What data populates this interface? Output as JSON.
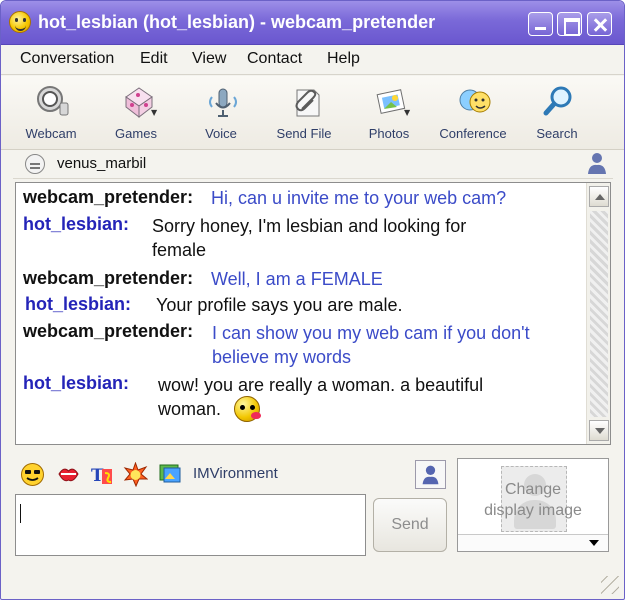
{
  "window": {
    "title": "hot_lesbian  (hot_lesbian) - webcam_pretender",
    "controls": [
      "minimize-icon",
      "maximize-icon",
      "close-icon"
    ]
  },
  "menu": {
    "items": [
      "Conversation",
      "Edit",
      "View",
      "Contact",
      "Help"
    ]
  },
  "toolbar": {
    "items": [
      {
        "label": "Webcam",
        "icon": "webcam-icon"
      },
      {
        "label": "Games",
        "icon": "dice-icon"
      },
      {
        "label": "Voice",
        "icon": "microphone-icon"
      },
      {
        "label": "Send File",
        "icon": "paperclip-file-icon"
      },
      {
        "label": "Photos",
        "icon": "photo-icon"
      },
      {
        "label": "Conference",
        "icon": "conference-icon"
      },
      {
        "label": "Search",
        "icon": "magnifier-icon"
      }
    ]
  },
  "contact": {
    "name": "venus_marbil",
    "status_icon": "contact-status-icon"
  },
  "conversation": {
    "messages": [
      {
        "sender": "webcam_pretender:",
        "text": "Hi, can u invite me to your web cam?",
        "sender_color": "#111111",
        "text_color": "#3b4bc8"
      },
      {
        "sender": "hot_lesbian:",
        "text": "Sorry honey, I'm lesbian and looking for female",
        "sender_color": "#2424b8",
        "text_color": "#111111"
      },
      {
        "sender": "webcam_pretender:",
        "text": "Well, I am a FEMALE",
        "sender_color": "#111111",
        "text_color": "#3b4bc8"
      },
      {
        "sender": "hot_lesbian:",
        "text": "Your profile says you are male.",
        "sender_color": "#2424b8",
        "text_color": "#111111"
      },
      {
        "sender": "webcam_pretender:",
        "text": "I can show you my web cam if you don't believe my words",
        "sender_color": "#111111",
        "text_color": "#3b4bc8"
      },
      {
        "sender": "hot_lesbian:",
        "text": "wow! you are really a woman. a beautiful woman.",
        "sender_color": "#2424b8",
        "text_color": "#111111"
      }
    ],
    "last_message_emoji": "kiss-smiley-icon"
  },
  "compose": {
    "tools": [
      "sunglasses-smiley-icon",
      "lips-icon",
      "text-format-icon",
      "nudge-icon",
      "imvironment-icon"
    ],
    "imvironment_label": "IMVironment",
    "input_value": "",
    "send_label": "Send"
  },
  "display_image": {
    "label_line1": "Change",
    "label_line2": "display image"
  },
  "colors": {
    "title_bar": "#7a69d8",
    "toolbar_label": "#2f3e68",
    "sender_self": "#111111",
    "sender_contact": "#2424b8",
    "message_blue": "#3b4bc8"
  }
}
